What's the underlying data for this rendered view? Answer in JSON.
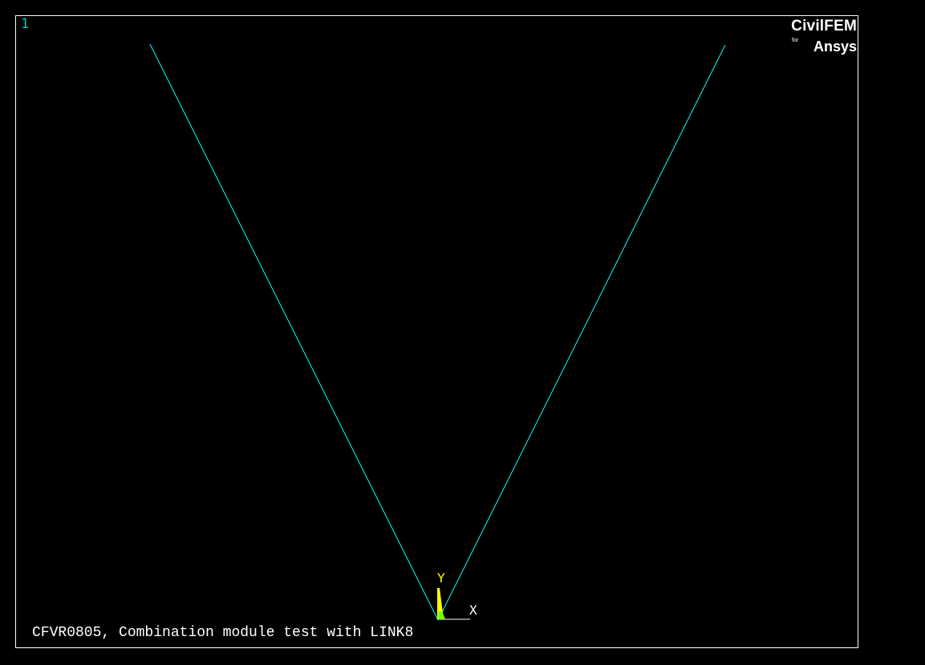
{
  "window": {
    "number": "1"
  },
  "logo": {
    "main": "CivilFEM",
    "for": "for",
    "ansys": "Ansys"
  },
  "triad": {
    "y_label": "Y",
    "x_label": "X"
  },
  "title": "CFVR0805, Combination module test with LINK8",
  "colors": {
    "background": "#000000",
    "frame": "#ffffff",
    "elements": "#00ffff",
    "window_number": "#00c8c8",
    "triad_y": "#ffff00",
    "triad_z": "#80ff00",
    "triad_x": "#ffffff",
    "title": "#ffffff"
  }
}
